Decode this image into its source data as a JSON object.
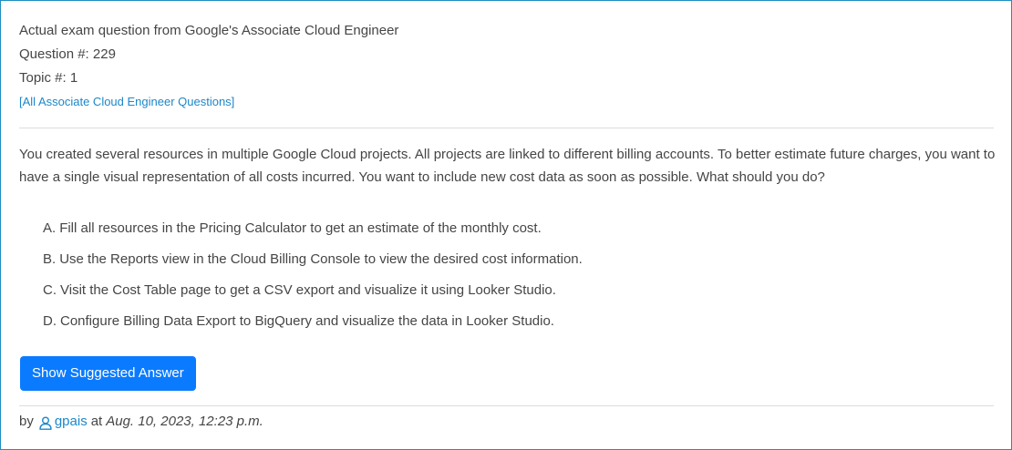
{
  "header": {
    "exam_line": "Actual exam question from Google's Associate Cloud Engineer",
    "question_number": "Question #: 229",
    "topic": "Topic #: 1",
    "all_questions_link": "[All Associate Cloud Engineer Questions]"
  },
  "question": {
    "text": "You created several resources in multiple Google Cloud projects. All projects are linked to different billing accounts. To better estimate future charges, you want to have a single visual representation of all costs incurred. You want to include new cost data as soon as possible. What should you do?"
  },
  "choices": [
    {
      "letter": "A.",
      "text": "Fill all resources in the Pricing Calculator to get an estimate of the monthly cost."
    },
    {
      "letter": "B.",
      "text": "Use the Reports view in the Cloud Billing Console to view the desired cost information."
    },
    {
      "letter": "C.",
      "text": "Visit the Cost Table page to get a CSV export and visualize it using Looker Studio."
    },
    {
      "letter": "D.",
      "text": "Configure Billing Data Export to BigQuery and visualize the data in Looker Studio."
    }
  ],
  "actions": {
    "show_answer_label": "Show Suggested Answer"
  },
  "footer": {
    "by": "by",
    "user_icon": "user-icon",
    "username": "gpais",
    "at": "at",
    "timestamp": "Aug. 10, 2023, 12:23 p.m."
  },
  "colors": {
    "border": "#1e8fc4",
    "link": "#1c87c9",
    "button": "#0a7bff",
    "text": "#454545"
  }
}
